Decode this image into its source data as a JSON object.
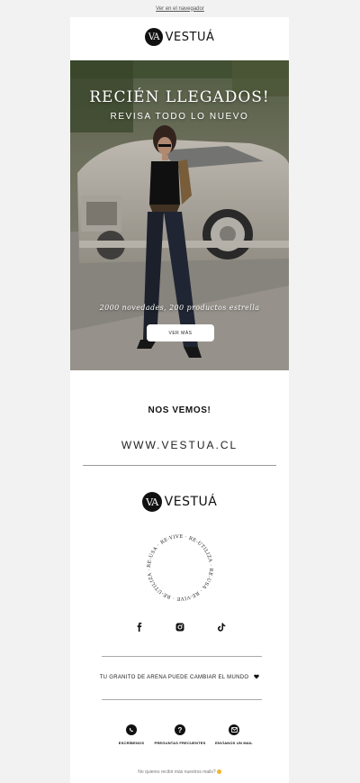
{
  "top_link": "Ver en el navegador",
  "brand": {
    "monogram": "VA",
    "name": "VESTUÁ"
  },
  "hero": {
    "title": "RECIÉN LLEGADOS!",
    "subtitle": "REVISA TODO LO NUEVO",
    "note": "2000 novedades, 200 productos estrella",
    "button": "VER MÁS"
  },
  "see_you": "NOS VEMOS!",
  "website": "WWW.VESTUA.CL",
  "ring_text": "RE-USA · RE-VIVE · RE-UTILIZA · RE-USA · RE-VIVE · RE-UTILIZA · ",
  "social": [
    {
      "icon": "facebook-icon"
    },
    {
      "icon": "instagram-icon"
    },
    {
      "icon": "tiktok-icon"
    }
  ],
  "tagline": "TU GRANITO DE ARENA PUEDE CAMBIAR EL MUNDO",
  "tagline_icon": "heart-icon",
  "contact": [
    {
      "icon": "whatsapp-icon",
      "label": "ESCRÍBENOS"
    },
    {
      "icon": "question-icon",
      "label": "PREGUNTAS FRECUENTES"
    },
    {
      "icon": "mail-icon",
      "label": "ENVÍANOS UN MAIL"
    }
  ],
  "unsubscribe": "No quieres recibir más nuestros mails?"
}
